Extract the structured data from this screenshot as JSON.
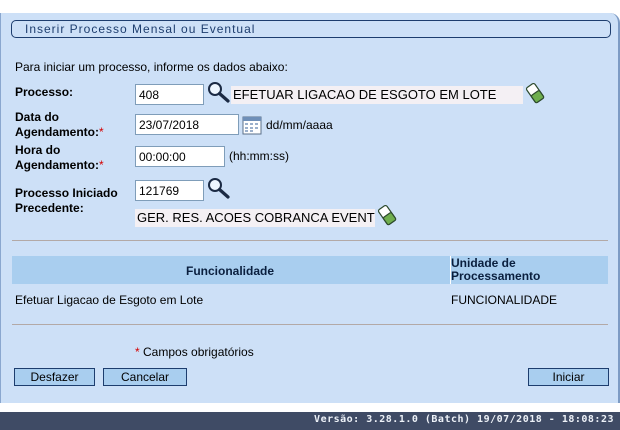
{
  "form": {
    "title": "Inserir Processo Mensal ou Eventual",
    "intro": "Para iniciar um processo, informe os dados abaixo:",
    "processo": {
      "label": "Processo:",
      "code": "408",
      "description": "EFETUAR LIGACAO DE ESGOTO EM LOTE"
    },
    "data": {
      "label1": "Data do",
      "label2": "Agendamento:",
      "required_mark": "*",
      "value": "23/07/2018",
      "hint": "dd/mm/aaaa"
    },
    "hora": {
      "label1": "Hora do",
      "label2": "Agendamento:",
      "required_mark": "*",
      "value": "00:00:00",
      "hint": "(hh:mm:ss)"
    },
    "precedente": {
      "label1": "Processo Iniciado",
      "label2": "Precedente:",
      "code": "121769",
      "description": "GER. RES. ACOES COBRANCA EVENT"
    }
  },
  "table": {
    "headers": {
      "funcionalidade": "Funcionalidade",
      "unidade1": "Unidade de",
      "unidade2": "Processamento"
    },
    "rows": [
      {
        "funcionalidade": "Efetuar Ligacao de Esgoto em Lote",
        "unidade": "FUNCIONALIDADE"
      }
    ]
  },
  "required_note": {
    "mark": "*",
    "text": " Campos obrigatórios"
  },
  "buttons": {
    "desfazer": "Desfazer",
    "cancelar": "Cancelar",
    "iniciar": "Iniciar"
  },
  "status": {
    "version": "Versão: 3.28.1.0 (Batch) 19/07/2018 - 18:08:23"
  },
  "icons": {
    "search": "magnifier-icon",
    "clear": "eraser-icon",
    "calendar": "calendar-icon"
  },
  "colors": {
    "panel": "#cde0f7",
    "header": "#a9ceef",
    "button": "#a9ceef",
    "status_bar": "#3f4b65",
    "required": "#d40000"
  }
}
